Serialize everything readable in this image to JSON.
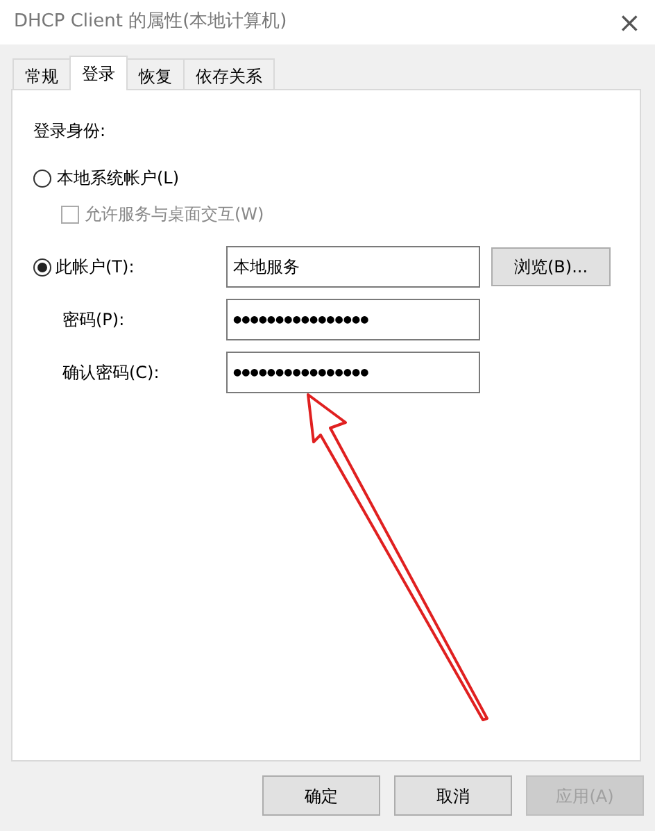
{
  "window": {
    "title": "DHCP Client 的属性(本地计算机)",
    "close": "×"
  },
  "tabs": [
    {
      "label": "常规",
      "selected": false
    },
    {
      "label": "登录",
      "selected": true
    },
    {
      "label": "恢复",
      "selected": false
    },
    {
      "label": "依存关系",
      "selected": false
    }
  ],
  "logon": {
    "heading": "登录身份:",
    "local_system": {
      "label": "本地系统帐户(L)",
      "selected": false
    },
    "interact": {
      "label": "允许服务与桌面交互(W)",
      "checked": false,
      "disabled": true
    },
    "this_account": {
      "label": "此帐户(T):",
      "selected": true,
      "value": "本地服务",
      "browse": "浏览(B)..."
    },
    "password": {
      "label": "密码(P):",
      "value": "●●●●●●●●●●●●●●●●"
    },
    "confirm": {
      "label": "确认密码(C):",
      "value": "●●●●●●●●●●●●●●●●"
    }
  },
  "buttons": [
    {
      "label": "确定",
      "disabled": false
    },
    {
      "label": "取消",
      "disabled": false
    },
    {
      "label": "应用(A)",
      "disabled": true
    }
  ],
  "annotation_arrow": {
    "color": "#e02020"
  }
}
